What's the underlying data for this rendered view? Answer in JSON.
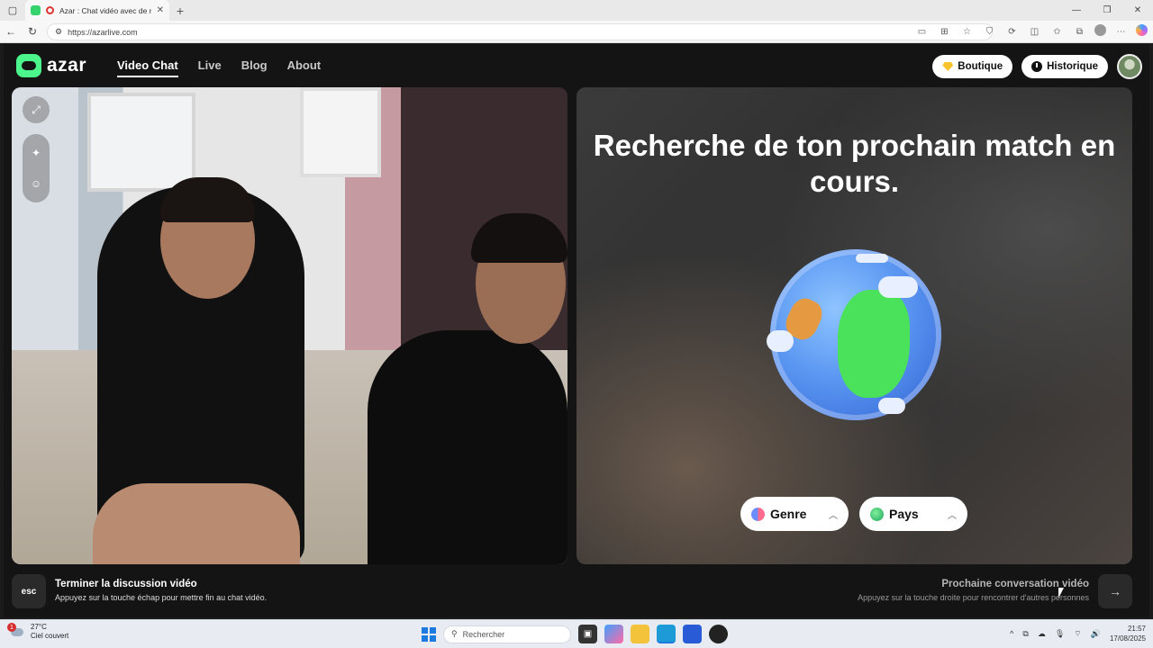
{
  "browser": {
    "tab_title": "Azar : Chat vidéo avec de no",
    "url": "https://azarlive.com"
  },
  "header": {
    "logo_text": "azar",
    "nav": [
      "Video Chat",
      "Live",
      "Blog",
      "About"
    ],
    "active_nav": "Video Chat",
    "shop_label": "Boutique",
    "history_label": "Historique"
  },
  "match": {
    "title": "Recherche de ton prochain match en cours.",
    "gender_filter": "Genre",
    "country_filter": "Pays"
  },
  "footer": {
    "esc_key": "esc",
    "end_title": "Terminer la discussion vidéo",
    "end_subtitle": "Appuyez sur la touche échap pour mettre fin au chat vidéo.",
    "next_title": "Prochaine conversation vidéo",
    "next_subtitle": "Appuyez sur la touche droite pour rencontrer d'autres personnes"
  },
  "taskbar": {
    "weather_badge": "1",
    "temperature": "27°C",
    "weather": "Ciel couvert",
    "search_placeholder": "Rechercher",
    "time": "21:57",
    "date": "17/08/2025"
  },
  "colors": {
    "brand_green": "#4cf58b",
    "app_bg": "#141414",
    "accent_gold": "#f7c52b"
  }
}
